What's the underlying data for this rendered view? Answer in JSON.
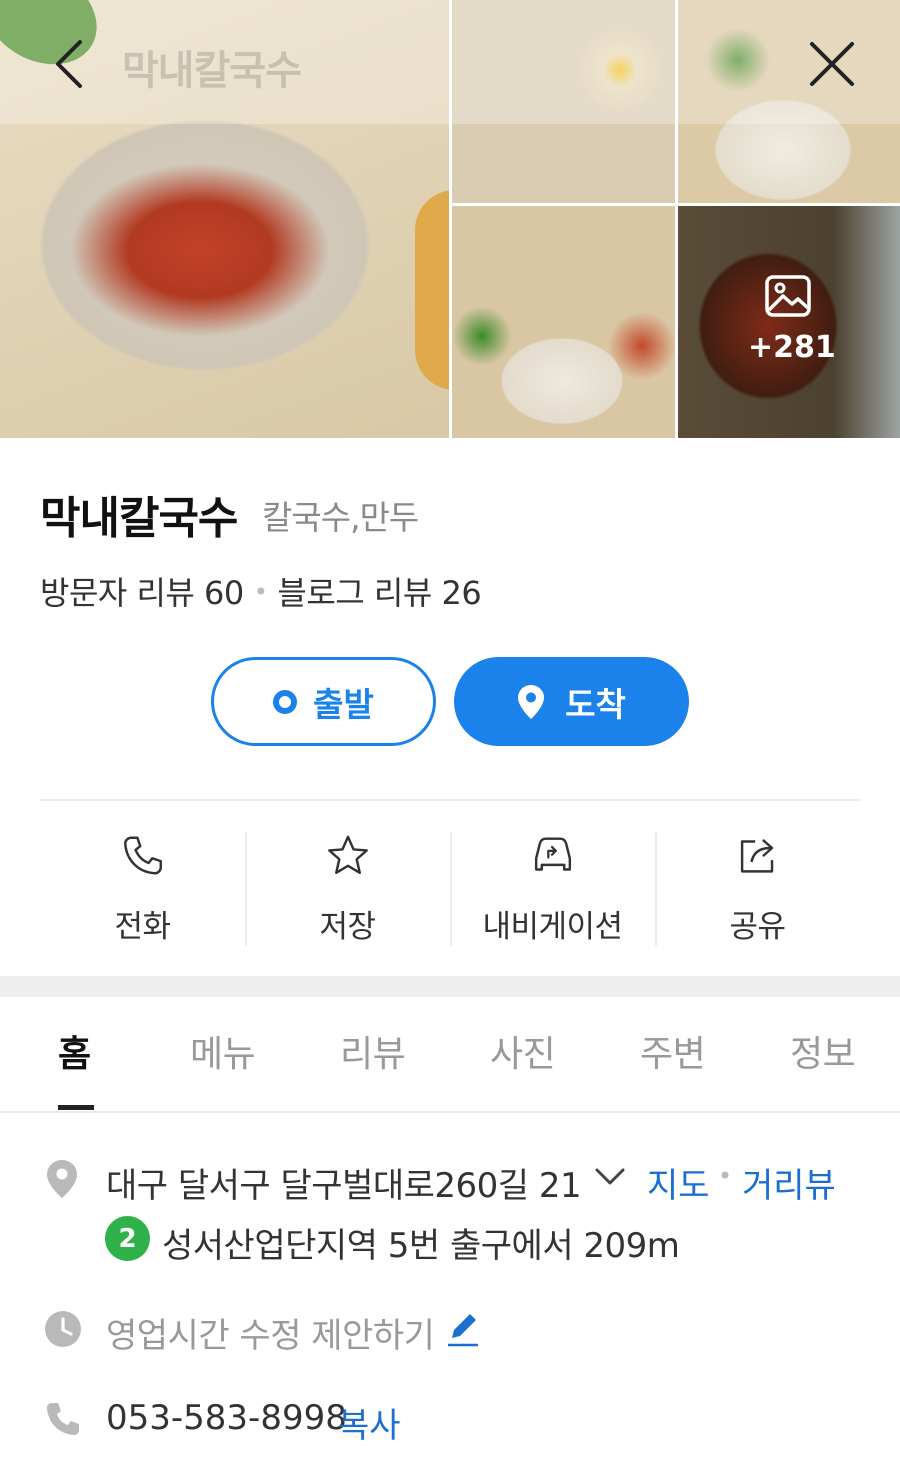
{
  "header": {
    "title": "막내칼국수"
  },
  "gallery": {
    "more_count": "+281"
  },
  "place": {
    "name": "막내칼국수",
    "category": "칼국수,만두",
    "visitor_reviews": "방문자 리뷰 60",
    "blog_reviews": "블로그 리뷰 26"
  },
  "route": {
    "depart_label": "출발",
    "arrive_label": "도착"
  },
  "actions": [
    {
      "label": "전화",
      "icon": "phone-icon"
    },
    {
      "label": "저장",
      "icon": "star-icon"
    },
    {
      "label": "내비게이션",
      "icon": "car-icon"
    },
    {
      "label": "공유",
      "icon": "share-icon"
    }
  ],
  "tabs": [
    "홈",
    "메뉴",
    "리뷰",
    "사진",
    "주변",
    "정보"
  ],
  "active_tab": "홈",
  "info": {
    "address": "대구 달서구 달구벌대로260길 21",
    "map_link": "지도",
    "roadview_link": "거리뷰",
    "subway_line": "2",
    "subway_text": "성서산업단지역 5번 출구에서 209m",
    "hours_text": "영업시간 수정 제안하기",
    "phone": "053-583-8998",
    "copy_label": "복사"
  },
  "colors": {
    "accent": "#1a82ea",
    "link": "#1a6fd1",
    "subway_line2": "#2fb24a"
  }
}
